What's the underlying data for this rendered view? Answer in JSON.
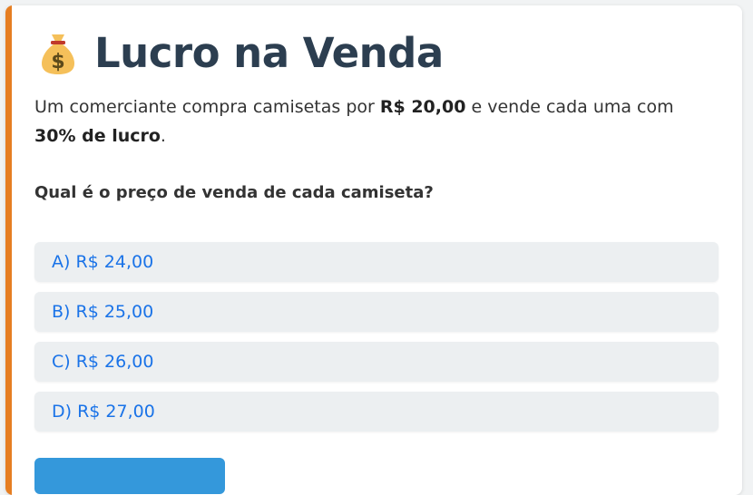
{
  "title": {
    "icon": "money-bag-icon",
    "text": "Lucro na Venda"
  },
  "statement": {
    "part1": "Um comerciante compra camisetas por ",
    "price": "R$ 20,00",
    "part2": " e vende cada uma com ",
    "profit": "30% de lucro",
    "part3": "."
  },
  "question": "Qual é o preço de venda de cada camiseta?",
  "options": [
    {
      "label": "A) R$ 24,00"
    },
    {
      "label": "B) R$ 25,00"
    },
    {
      "label": "C) R$ 26,00"
    },
    {
      "label": "D) R$ 27,00"
    }
  ],
  "colors": {
    "accent": "#e67e22",
    "title": "#2c3e50",
    "option_text": "#1a73e8",
    "option_bg": "#eceff1",
    "button": "#3498db"
  }
}
